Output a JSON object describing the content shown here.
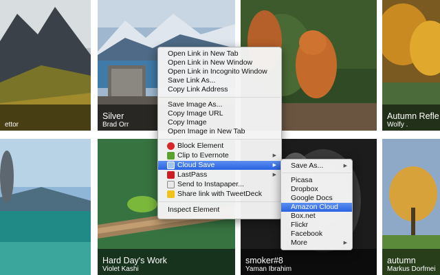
{
  "gallery": {
    "tiles": [
      {
        "title": "",
        "author": "ettor"
      },
      {
        "title": "Silver",
        "author": "Brad Orr"
      },
      {
        "title": "",
        "author": ""
      },
      {
        "title": "Autumn Refle",
        "author": "Wolfy ."
      },
      {
        "title": "",
        "author": ""
      },
      {
        "title": "Hard Day's Work",
        "author": "Violet Kashi"
      },
      {
        "title": "smoker#8",
        "author": "Yaman Ibrahim"
      },
      {
        "title": "autumn",
        "author": "Markus Dorfmei"
      }
    ]
  },
  "context_menu": {
    "link_items": [
      "Open Link in New Tab",
      "Open Link in New Window",
      "Open Link in Incognito Window",
      "Save Link As...",
      "Copy Link Address"
    ],
    "image_items": [
      "Save Image As...",
      "Copy Image URL",
      "Copy Image",
      "Open Image in New Tab"
    ],
    "extension_items": [
      {
        "label": "Block Element",
        "icon": "adblock-icon",
        "color": "#d9262a"
      },
      {
        "label": "Clip to Evernote",
        "icon": "evernote-icon",
        "color": "#5aa02c"
      },
      {
        "label": "Cloud Save",
        "icon": "cloud-save-icon",
        "color": "#4b8ad6"
      },
      {
        "label": "LastPass",
        "icon": "lastpass-icon",
        "color": "#cc1f24"
      },
      {
        "label": "Send to Instapaper...",
        "icon": "instapaper-icon",
        "color": "#e8e8e8"
      },
      {
        "label": "Share link with TweetDeck",
        "icon": "tweetdeck-icon",
        "color": "#f2c21b"
      }
    ],
    "inspect_label": "Inspect Element"
  },
  "cloud_submenu": {
    "save_as_label": "Save As...",
    "services": [
      "Picasa",
      "Dropbox",
      "Google Docs",
      "Amazon Cloud",
      "Box.net",
      "Flickr",
      "Facebook"
    ],
    "more_label": "More"
  },
  "colors": {
    "highlight": "#3a72e6",
    "menu_bg": "#f4f4f4",
    "caption_bg": "rgba(0,0,0,0.55)"
  }
}
